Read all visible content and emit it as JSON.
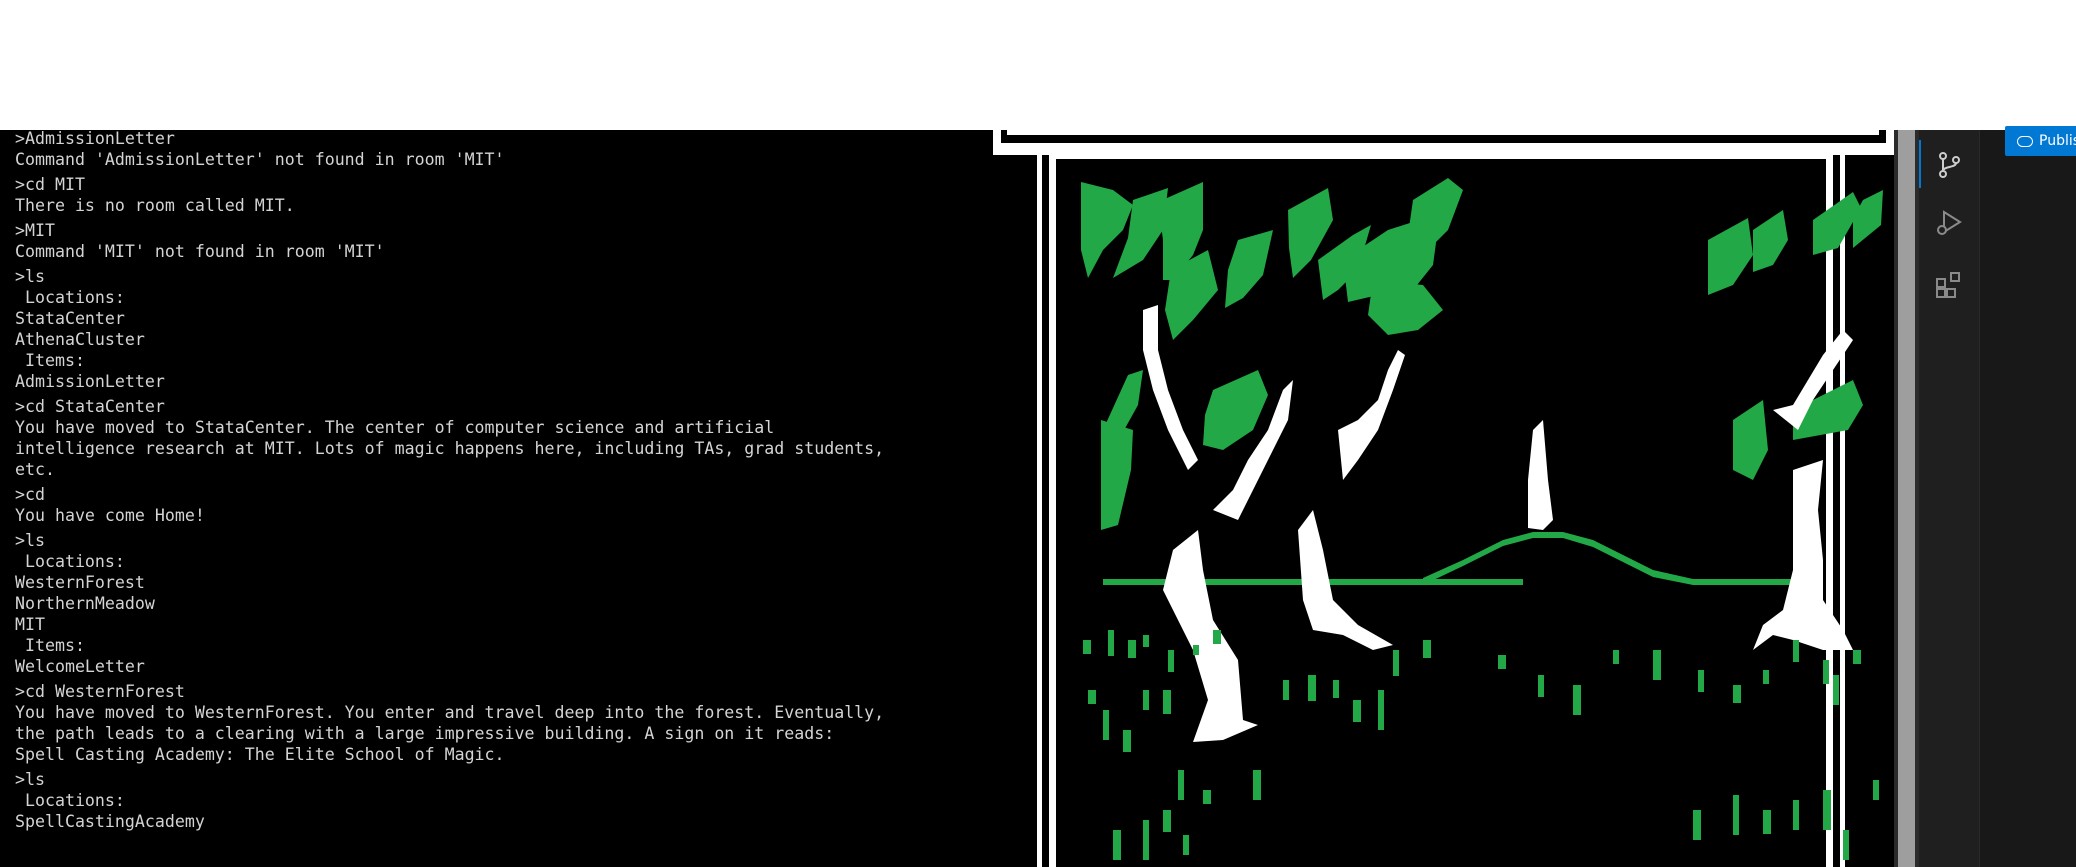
{
  "terminal": {
    "lines": [
      {
        "text": ">AdmissionLetter",
        "kind": "cmd"
      },
      {
        "text": "Command 'AdmissionLetter' not found in room 'MIT'",
        "kind": "out"
      },
      {
        "text": ">cd MIT",
        "kind": "cmd"
      },
      {
        "text": "There is no room called MIT.",
        "kind": "out"
      },
      {
        "text": ">MIT",
        "kind": "cmd"
      },
      {
        "text": "Command 'MIT' not found in room 'MIT'",
        "kind": "out"
      },
      {
        "text": ">ls",
        "kind": "cmd"
      },
      {
        "text": " Locations:",
        "kind": "out"
      },
      {
        "text": "StataCenter",
        "kind": "out"
      },
      {
        "text": "AthenaCluster",
        "kind": "out"
      },
      {
        "text": " Items:",
        "kind": "out"
      },
      {
        "text": "AdmissionLetter",
        "kind": "out"
      },
      {
        "text": ">cd StataCenter",
        "kind": "cmd"
      },
      {
        "text": "You have moved to StataCenter. The center of computer science and artificial",
        "kind": "out"
      },
      {
        "text": "intelligence research at MIT. Lots of magic happens here, including TAs, grad students,",
        "kind": "out"
      },
      {
        "text": "etc.",
        "kind": "out"
      },
      {
        "text": ">cd",
        "kind": "cmd"
      },
      {
        "text": "You have come Home!",
        "kind": "out"
      },
      {
        "text": ">ls",
        "kind": "cmd"
      },
      {
        "text": " Locations:",
        "kind": "out"
      },
      {
        "text": "WesternForest",
        "kind": "out"
      },
      {
        "text": "NorthernMeadow",
        "kind": "out"
      },
      {
        "text": "MIT",
        "kind": "out"
      },
      {
        "text": " Items:",
        "kind": "out"
      },
      {
        "text": "WelcomeLetter",
        "kind": "out"
      },
      {
        "text": ">cd WesternForest",
        "kind": "cmd"
      },
      {
        "text": "You have moved to WesternForest. You enter and travel deep into the forest. Eventually,",
        "kind": "out"
      },
      {
        "text": "the path leads to a clearing with a large impressive building. A sign on it reads:",
        "kind": "out"
      },
      {
        "text": "Spell Casting Academy: The Elite School of Magic.",
        "kind": "out"
      },
      {
        "text": ">ls",
        "kind": "cmd"
      },
      {
        "text": " Locations:",
        "kind": "out"
      },
      {
        "text": "SpellCastingAcademy",
        "kind": "out"
      }
    ]
  },
  "art": {
    "leaf_color": "#22a846",
    "trunk_color": "#ffffff",
    "background_color": "#000000"
  },
  "activity_bar": {
    "icons": [
      "source-control-icon",
      "run-debug-icon",
      "extensions-icon"
    ],
    "accent_color": "#0078d4"
  },
  "side_panel": {
    "publish_label": "Publish"
  }
}
